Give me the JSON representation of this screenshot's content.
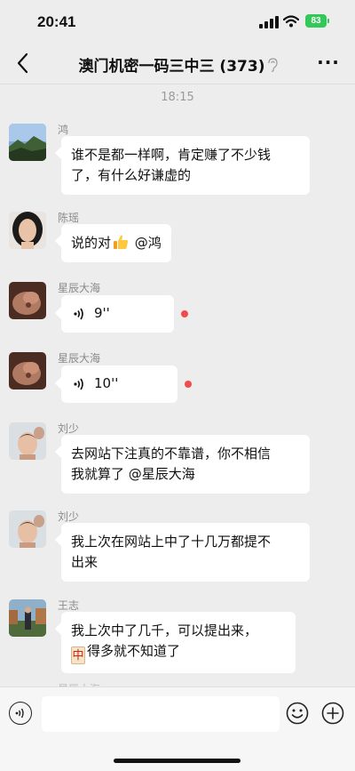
{
  "status_bar": {
    "time": "20:41",
    "battery": "83"
  },
  "nav": {
    "title": "澳门机密一码三中三 (373)",
    "more_label": "···"
  },
  "timestamp": "18:15",
  "messages": [
    {
      "sender": "鸿",
      "lines": [
        "谁不是都一样啊，肯定赚了不少钱",
        "了，有什么好谦虚的"
      ]
    },
    {
      "sender": "陈瑶",
      "text_before": "说的对",
      "emoji": "thumbs-up",
      "text_after": " @鸿"
    },
    {
      "sender": "星辰大海",
      "voice_duration": "9''"
    },
    {
      "sender": "星辰大海",
      "voice_duration": "10''"
    },
    {
      "sender": "刘少",
      "lines": [
        "去网站下注真的不靠谱，你不相信",
        "我就算了 @星辰大海"
      ]
    },
    {
      "sender": "刘少",
      "lines": [
        "我上次在网站上中了十几万都提不",
        "出来"
      ]
    },
    {
      "sender": "王志",
      "line1": "我上次中了几千，可以提出来，",
      "mahjong_tile": "中",
      "line2_after": "得多就不知道了"
    }
  ],
  "partial_sender": "星辰大海",
  "input": {
    "placeholder": ""
  },
  "icons": [
    "back-arrow-icon",
    "mute-ear-icon",
    "more-dots-icon",
    "voice-icon",
    "emoji-icon",
    "plus-icon"
  ]
}
